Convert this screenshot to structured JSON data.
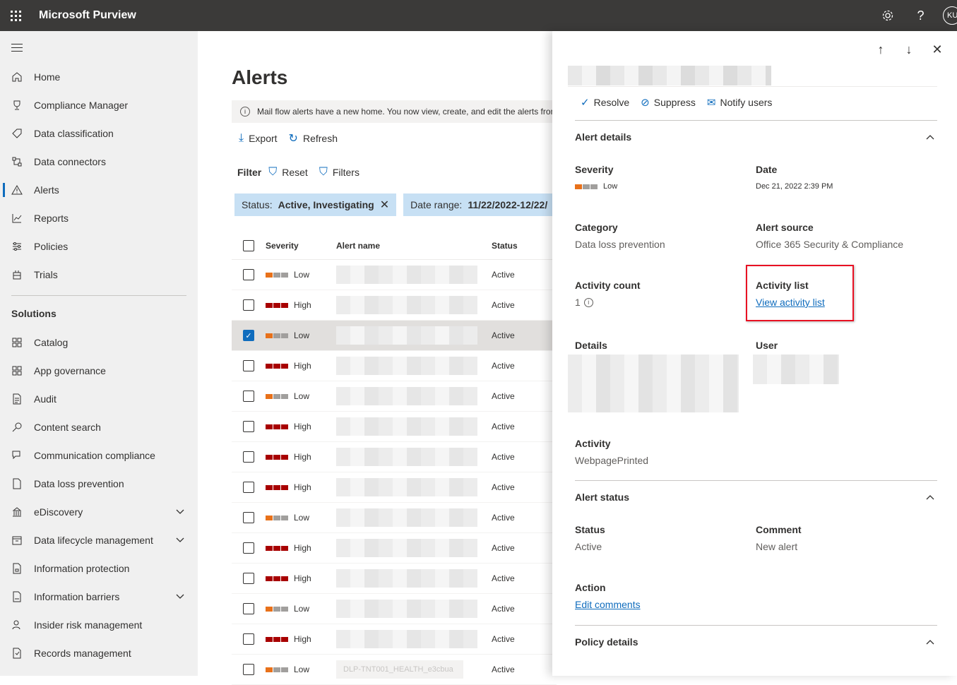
{
  "app": {
    "title": "Microsoft Purview",
    "avatar": "KU"
  },
  "sidebar": {
    "items": [
      {
        "label": "Home",
        "icon": "home-icon"
      },
      {
        "label": "Compliance Manager",
        "icon": "trophy-icon"
      },
      {
        "label": "Data classification",
        "icon": "tag-icon"
      },
      {
        "label": "Data connectors",
        "icon": "connector-icon"
      },
      {
        "label": "Alerts",
        "icon": "warning-icon"
      },
      {
        "label": "Reports",
        "icon": "chart-icon"
      },
      {
        "label": "Policies",
        "icon": "sliders-icon"
      },
      {
        "label": "Trials",
        "icon": "trials-icon"
      }
    ],
    "solutions_heading": "Solutions",
    "solutions": [
      {
        "label": "Catalog"
      },
      {
        "label": "App governance"
      },
      {
        "label": "Audit"
      },
      {
        "label": "Content search"
      },
      {
        "label": "Communication compliance"
      },
      {
        "label": "Data loss prevention"
      },
      {
        "label": "eDiscovery"
      },
      {
        "label": "Data lifecycle management"
      },
      {
        "label": "Information protection"
      },
      {
        "label": "Information barriers"
      },
      {
        "label": "Insider risk management"
      },
      {
        "label": "Records management"
      }
    ]
  },
  "main": {
    "title": "Alerts",
    "banner": "Mail flow alerts have a new home. You now view, create, and edit the alerts from",
    "export_label": "Export",
    "refresh_label": "Refresh",
    "filter_label": "Filter",
    "reset_label": "Reset",
    "filters_label": "Filters",
    "pill_status_key": "Status:",
    "pill_status_value": "Active, Investigating",
    "pill_date_key": "Date range:",
    "pill_date_value": "11/22/2022-12/22/",
    "columns": {
      "severity": "Severity",
      "name": "Alert name",
      "status": "Status"
    },
    "rows": [
      {
        "severity": "Low",
        "status": "Active"
      },
      {
        "severity": "High",
        "status": "Active"
      },
      {
        "severity": "Low",
        "status": "Active"
      },
      {
        "severity": "High",
        "status": "Active"
      },
      {
        "severity": "Low",
        "status": "Active"
      },
      {
        "severity": "High",
        "status": "Active"
      },
      {
        "severity": "High",
        "status": "Active"
      },
      {
        "severity": "High",
        "status": "Active"
      },
      {
        "severity": "Low",
        "status": "Active"
      },
      {
        "severity": "High",
        "status": "Active"
      },
      {
        "severity": "High",
        "status": "Active"
      },
      {
        "severity": "Low",
        "status": "Active"
      },
      {
        "severity": "High",
        "status": "Active"
      },
      {
        "severity": "Low",
        "status": "Active",
        "name": "DLP-TNT001_HEALTH_e3cbua"
      }
    ]
  },
  "panel": {
    "resolve": "Resolve",
    "suppress": "Suppress",
    "notify": "Notify users",
    "alert_details": "Alert details",
    "severity_label": "Severity",
    "severity_value": "Low",
    "date_label": "Date",
    "date_value": "Dec 21, 2022 2:39 PM",
    "category_label": "Category",
    "category_value": "Data loss prevention",
    "source_label": "Alert source",
    "source_value": "Office 365 Security & Compliance",
    "count_label": "Activity count",
    "count_value": "1",
    "activity_list_label": "Activity list",
    "activity_list_link": "View activity list",
    "details_label": "Details",
    "user_label": "User",
    "activity_label": "Activity",
    "activity_value": "WebpagePrinted",
    "alert_status": "Alert status",
    "status_label": "Status",
    "status_value": "Active",
    "comment_label": "Comment",
    "comment_value": "New alert",
    "action_label": "Action",
    "edit_comments": "Edit comments",
    "policy_details": "Policy details"
  },
  "colors": {
    "low": "#e8711a",
    "high": "#a80000",
    "gray": "#a19f9d",
    "accent": "#0f6cbd",
    "highlight": "#e81123"
  }
}
